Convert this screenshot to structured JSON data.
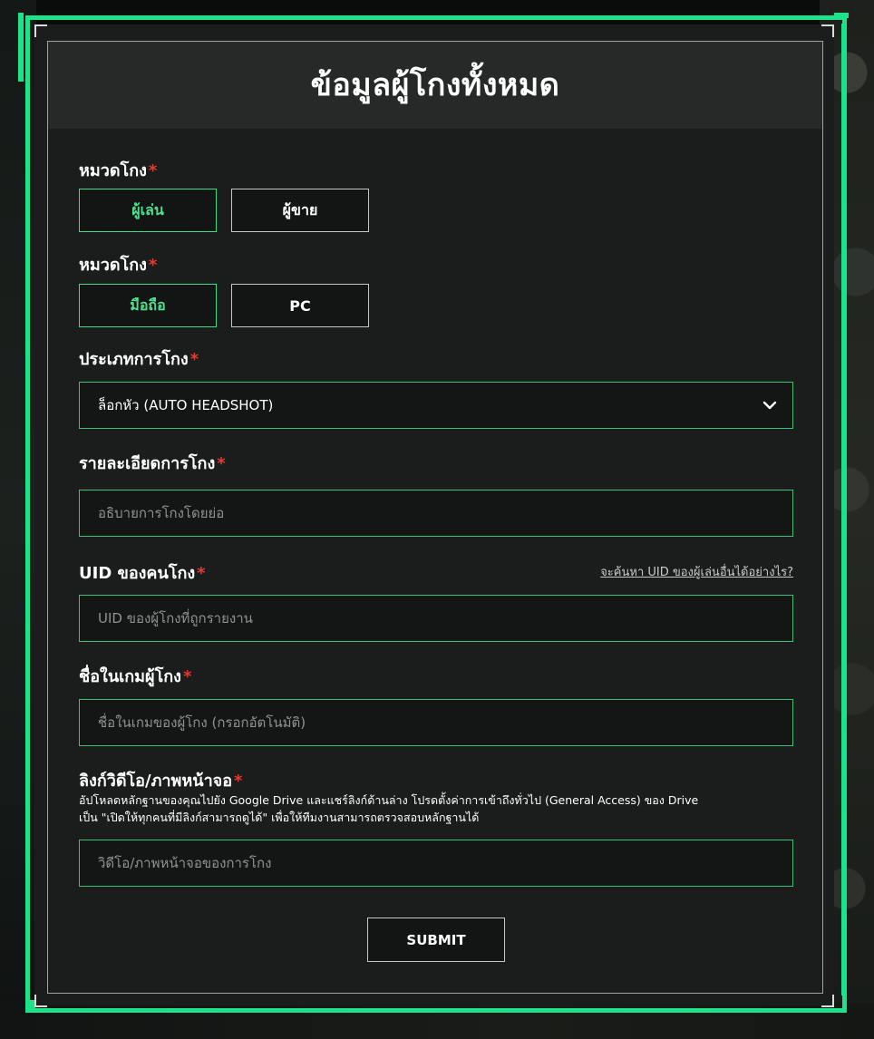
{
  "form": {
    "title": "ข้อมูลผู้โกงทั้งหมด",
    "required_mark": "*",
    "category1": {
      "label": "หมวดโกง",
      "options": [
        "ผู้เล่น",
        "ผู้ขาย"
      ],
      "selected": "ผู้เล่น"
    },
    "category2": {
      "label": "หมวดโกง",
      "options": [
        "มือถือ",
        "PC"
      ],
      "selected": "มือถือ"
    },
    "cheat_type": {
      "label": "ประเภทการโกง",
      "selected_value": "ล็อกหัว (AUTO HEADSHOT)"
    },
    "details": {
      "label": "รายละเอียดการโกง",
      "placeholder": "อธิบายการโกงโดยย่อ"
    },
    "uid": {
      "label": "UID ของคนโกง",
      "help_link": "จะค้นหา UID ของผู้เล่นอื่นได้อย่างไร?",
      "placeholder": "UID ของผู้โกงที่ถูกรายงาน"
    },
    "ingame_name": {
      "label": "ชื่อในเกมผู้โกง",
      "placeholder": "ชื่อในเกมของผู้โกง (กรอกอัตโนมัติ)"
    },
    "evidence": {
      "label": "ลิงก์วิดีโอ/ภาพหน้าจอ",
      "note_line1": "อัปโหลดหลักฐานของคุณไปยัง Google Drive และแชร์ลิงก์ด้านล่าง โปรดตั้งค่าการเข้าถึงทั่วไป (General Access) ของ Drive",
      "note_line2": "เป็น \"เปิดให้ทุกคนที่มีลิงก์สามารถดูได้\" เพื่อให้ทีมงานสามารถตรวจสอบหลักฐานได้",
      "placeholder": "วิดีโอ/ภาพหน้าจอของการโกง"
    },
    "submit_label": "SUBMIT"
  },
  "colors": {
    "accent": "#1ce38a",
    "selected_text": "#4ee08f",
    "required": "#e53935",
    "panel": "#1b1d1c"
  },
  "icons": {
    "dropdown": "chevron-down-icon"
  }
}
